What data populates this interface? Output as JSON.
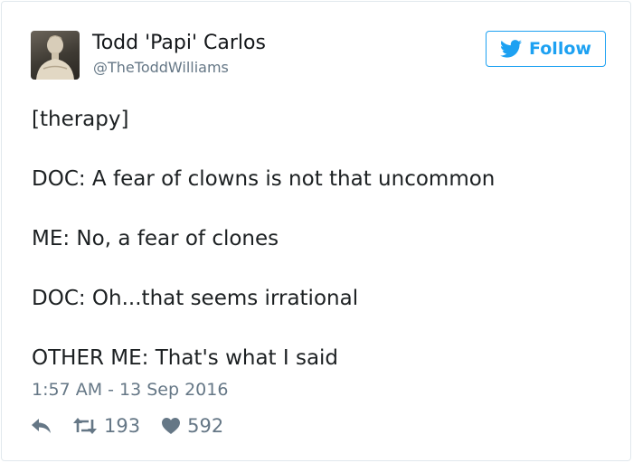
{
  "user": {
    "display_name": "Todd 'Papi' Carlos",
    "handle": "@TheToddWilliams"
  },
  "follow_button": {
    "label": "Follow",
    "icon": "twitter-bird-icon"
  },
  "tweet": {
    "lines": [
      "[therapy]",
      "DOC: A fear of clowns is not that uncommon",
      "ME: No, a fear of clones",
      "DOC: Oh...that seems irrational",
      "OTHER ME: That's what I said"
    ],
    "timestamp": "1:57 AM - 13 Sep 2016"
  },
  "actions": {
    "reply": {
      "icon": "reply-icon"
    },
    "retweet": {
      "icon": "retweet-icon",
      "count": "193"
    },
    "like": {
      "icon": "heart-icon",
      "count": "592"
    }
  },
  "colors": {
    "accent": "#1da1f2",
    "text": "#1c2022",
    "muted": "#657786",
    "border": "#e1e8ed"
  }
}
